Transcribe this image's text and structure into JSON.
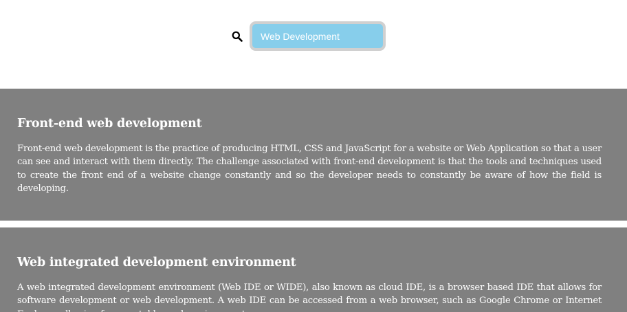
{
  "search": {
    "icon": "search-icon",
    "value": "Web Development"
  },
  "sections": [
    {
      "title": "Front-end web development",
      "body": "Front-end web development is the practice of producing HTML, CSS and JavaScript for a website or Web Application so that a user can see and interact with them directly. The challenge associated with front-end development is that the tools and techniques used to create the front end of a website change constantly and so the developer needs to constantly be aware of how the field is developing."
    },
    {
      "title": "Web integrated development environment",
      "body": "A web integrated development environment (Web IDE or WIDE), also known as cloud IDE, is a browser based IDE that allows for software development or web development. A web IDE can be accessed from a web browser, such as Google Chrome or Internet Explorer, allowing for a portable work environment."
    }
  ],
  "colors": {
    "section_background": "#808080",
    "search_background": "#87ceeb",
    "search_border": "#d0d0d0"
  }
}
